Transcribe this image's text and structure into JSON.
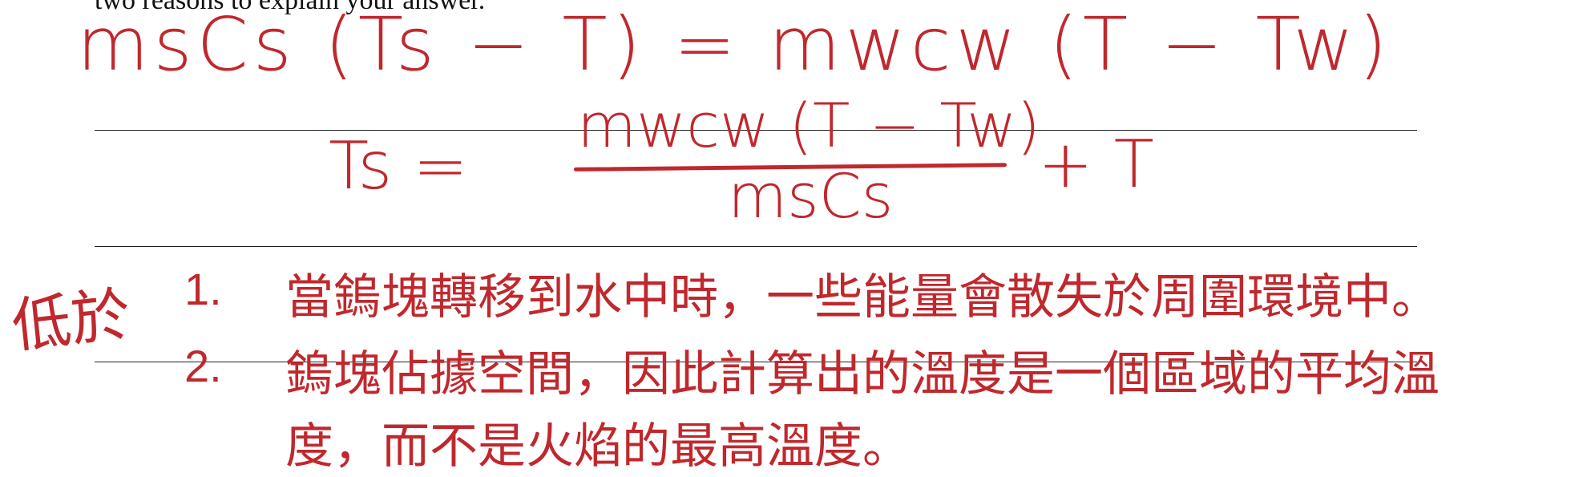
{
  "printed_text": "two reasons to explain your answer.",
  "handwriting": {
    "equation_1": "msCs (Ts − T) = mwcw (T − Tw)",
    "equation_2_lhs": "Ts =",
    "equation_2_numerator": "mwcw (T − Tw)",
    "equation_2_denominator": "msCs",
    "equation_2_rhs": "+ T",
    "margin_note": "低於"
  },
  "answers": [
    {
      "marker": "1.",
      "text": "當鎢塊轉移到水中時，一些能量會散失於周圍環境中。"
    },
    {
      "marker": "2.",
      "text": "鎢塊佔據空間，因此計算出的溫度是一個區域的平均溫",
      "continuation": "度，而不是火焰的最高溫度。"
    }
  ],
  "colors": {
    "ink": "#c0282d",
    "print": "#111111",
    "rule": "#222222"
  }
}
